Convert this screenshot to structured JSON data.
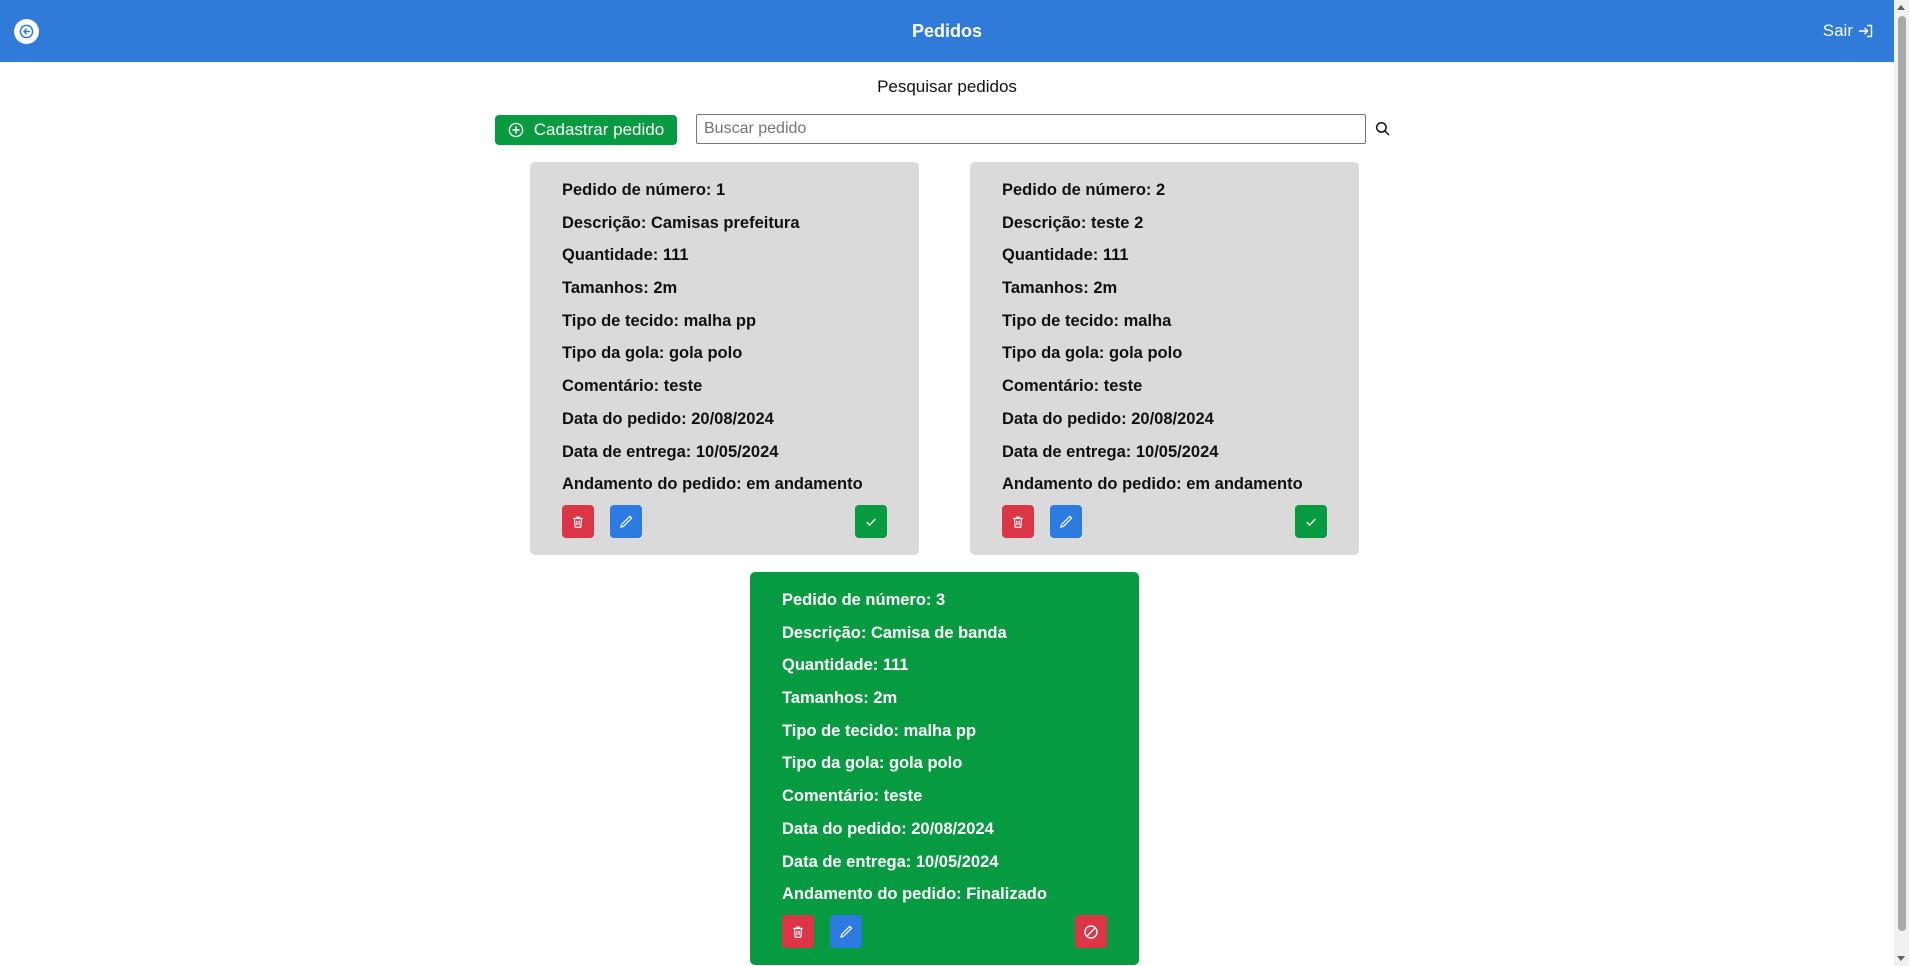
{
  "header": {
    "title": "Pedidos",
    "logout_label": "Sair",
    "color": "#307bd9"
  },
  "search": {
    "title": "Pesquisar pedidos",
    "add_label": "Cadastrar pedido",
    "placeholder": "Buscar pedido",
    "value": ""
  },
  "colors": {
    "pending_card": "#dadada",
    "done_card": "#069a41",
    "delete": "#dc3545",
    "edit": "#2c7be0",
    "confirm": "#069a41"
  },
  "orders": [
    {
      "status": "pending",
      "numero": "Pedido de número: 1",
      "descricao": "Descrição: Camisas prefeitura",
      "quantidade": "Quantidade: 111",
      "tamanhos": "Tamanhos: 2m",
      "tecido": "Tipo de tecido: malha pp",
      "gola": "Tipo da gola: gola polo",
      "comentario": "Comentário: teste",
      "data_pedido": "Data do pedido: 20/08/2024",
      "data_entrega": "Data de entrega: 10/05/2024",
      "andamento": "Andamento do pedido: em andamento"
    },
    {
      "status": "pending",
      "numero": "Pedido de número: 2",
      "descricao": "Descrição: teste 2",
      "quantidade": "Quantidade: 111",
      "tamanhos": "Tamanhos: 2m",
      "tecido": "Tipo de tecido: malha",
      "gola": "Tipo da gola: gola polo",
      "comentario": "Comentário: teste",
      "data_pedido": "Data do pedido: 20/08/2024",
      "data_entrega": "Data de entrega: 10/05/2024",
      "andamento": "Andamento do pedido: em andamento"
    },
    {
      "status": "done",
      "numero": "Pedido de número: 3",
      "descricao": "Descrição: Camisa de banda",
      "quantidade": "Quantidade: 111",
      "tamanhos": "Tamanhos: 2m",
      "tecido": "Tipo de tecido: malha pp",
      "gola": "Tipo da gola: gola polo",
      "comentario": "Comentário: teste",
      "data_pedido": "Data do pedido: 20/08/2024",
      "data_entrega": "Data de entrega: 10/05/2024",
      "andamento": "Andamento do pedido: Finalizado"
    }
  ]
}
